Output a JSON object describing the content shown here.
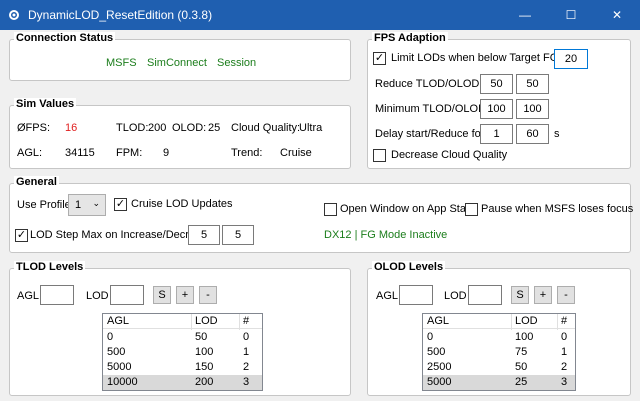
{
  "window": {
    "title": "DynamicLOD_ResetEdition (0.3.8)",
    "minimize_glyph": "—",
    "maximize_glyph": "☐",
    "close_glyph": "✕",
    "icon": "gear-icon"
  },
  "connection": {
    "title": "Connection Status",
    "msfs": "MSFS",
    "simconnect": "SimConnect",
    "session": "Session"
  },
  "sim_values": {
    "title": "Sim Values",
    "fps_label": "ØFPS:",
    "fps_value": "16",
    "tlod_label": "TLOD:",
    "tlod_value": "200",
    "olod_label": "OLOD:",
    "olod_value": "25",
    "cloud_label": "Cloud Quality:",
    "cloud_value": "Ultra",
    "agl_label": "AGL:",
    "agl_value": "34115",
    "fpm_label": "FPM:",
    "fpm_value": "9",
    "trend_label": "Trend:",
    "trend_value": "Cruise"
  },
  "fps_adaption": {
    "title": "FPS Adaption",
    "limit_label": "Limit LODs when below Target FG FPS:",
    "limit_checked": true,
    "target_fps": "20",
    "reduce_label": "Reduce TLOD/OLOD by",
    "reduce_tlod": "50",
    "reduce_olod": "50",
    "minimum_label": "Minimum TLOD/OLOD",
    "min_tlod": "100",
    "min_olod": "100",
    "delay_label": "Delay start/Reduce for",
    "delay_start": "1",
    "delay_reduce": "60",
    "delay_unit": "s",
    "decrease_cloud_label": "Decrease Cloud Quality",
    "decrease_cloud_checked": false
  },
  "general": {
    "title": "General",
    "use_profile_label": "Use Profile",
    "profile_value": "1",
    "cruise_label": "Cruise LOD Updates",
    "cruise_checked": true,
    "open_window_label": "Open Window on App Start",
    "open_window_checked": false,
    "pause_label": "Pause when MSFS loses focus",
    "pause_checked": false,
    "lod_step_label": "LOD Step Max on Increase/Decrease",
    "lod_step_checked": true,
    "step_increase": "5",
    "step_decrease": "5",
    "dx_status": "DX12 | FG Mode Inactive"
  },
  "tlod": {
    "title": "TLOD Levels",
    "agl_label": "AGL",
    "lod_label": "LOD",
    "agl_input": "",
    "lod_input": "",
    "set_btn": "S",
    "add_btn": "+",
    "remove_btn": "-",
    "columns": [
      "AGL",
      "LOD",
      "#"
    ],
    "rows": [
      [
        "0",
        "50",
        "0"
      ],
      [
        "500",
        "100",
        "1"
      ],
      [
        "5000",
        "150",
        "2"
      ],
      [
        "10000",
        "200",
        "3"
      ]
    ]
  },
  "olod": {
    "title": "OLOD Levels",
    "agl_label": "AGL",
    "lod_label": "LOD",
    "agl_input": "",
    "lod_input": "",
    "set_btn": "S",
    "add_btn": "+",
    "remove_btn": "-",
    "columns": [
      "AGL",
      "LOD",
      "#"
    ],
    "rows": [
      [
        "0",
        "100",
        "0"
      ],
      [
        "500",
        "75",
        "1"
      ],
      [
        "2500",
        "50",
        "2"
      ],
      [
        "5000",
        "25",
        "3"
      ]
    ]
  },
  "check_glyph": "✓"
}
